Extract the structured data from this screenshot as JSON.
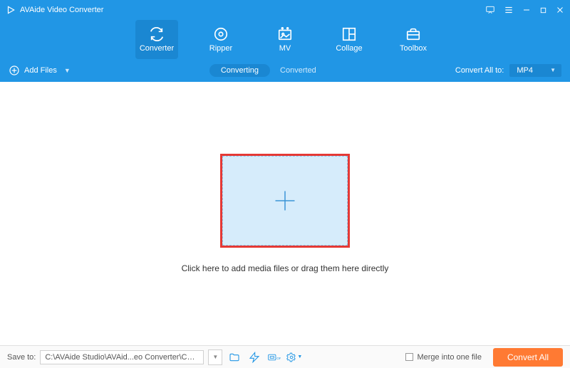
{
  "titlebar": {
    "title": "AVAide Video Converter"
  },
  "nav": {
    "items": [
      {
        "label": "Converter"
      },
      {
        "label": "Ripper"
      },
      {
        "label": "MV"
      },
      {
        "label": "Collage"
      },
      {
        "label": "Toolbox"
      }
    ]
  },
  "subbar": {
    "add_files": "Add Files",
    "tab_converting": "Converting",
    "tab_converted": "Converted",
    "convert_all_to": "Convert All to:",
    "format": "MP4"
  },
  "main": {
    "drop_text": "Click here to add media files or drag them here directly"
  },
  "footer": {
    "save_to_label": "Save to:",
    "save_path": "C:\\AVAide Studio\\AVAid...eo Converter\\Converted",
    "merge_label": "Merge into one file",
    "convert_all": "Convert All"
  }
}
